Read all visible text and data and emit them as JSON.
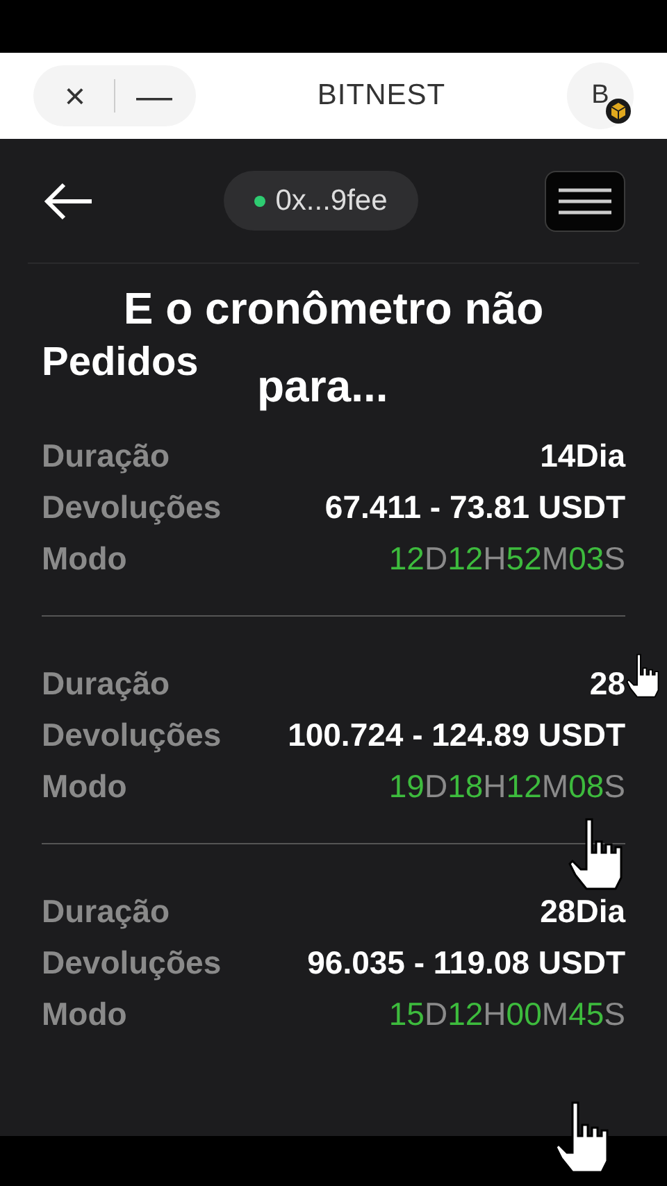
{
  "header": {
    "close": "×",
    "minimize": "—",
    "title": "BITNEST",
    "avatar": "B"
  },
  "nav": {
    "wallet": "0x...9fee",
    "connected": true
  },
  "caption": {
    "line_1": "E o cronômetro não",
    "line_2": "para..."
  },
  "page_title": "Pedidos",
  "orders": [
    {
      "duration_label": "Duração",
      "duration": "14Dia",
      "returns_label": "Devoluções",
      "returns": "67.411 - 73.81 USDT",
      "mode_label": "Modo",
      "timer": [
        {
          "kind": "number",
          "text": "12"
        },
        {
          "kind": "unit",
          "text": "D"
        },
        {
          "kind": "number",
          "text": "12"
        },
        {
          "kind": "unit",
          "text": "H"
        },
        {
          "kind": "number",
          "text": "52"
        },
        {
          "kind": "unit",
          "text": "M"
        },
        {
          "kind": "number",
          "text": "03"
        },
        {
          "kind": "unit",
          "text": "S"
        }
      ]
    },
    {
      "duration_label": "Duração",
      "duration": "28",
      "returns_label": "Devoluções",
      "returns": "100.724 - 124.89 USDT",
      "mode_label": "Modo",
      "timer": [
        {
          "kind": "number",
          "text": "19"
        },
        {
          "kind": "unit",
          "text": "D"
        },
        {
          "kind": "number",
          "text": "18"
        },
        {
          "kind": "unit",
          "text": "H"
        },
        {
          "kind": "number",
          "text": "12"
        },
        {
          "kind": "unit",
          "text": "M"
        },
        {
          "kind": "number",
          "text": "08"
        },
        {
          "kind": "unit",
          "text": "S"
        }
      ]
    },
    {
      "duration_label": "Duração",
      "duration": "28Dia",
      "returns_label": "Devoluções",
      "returns": "96.035 - 119.08 USDT",
      "mode_label": "Modo",
      "timer": [
        {
          "kind": "number",
          "text": "15"
        },
        {
          "kind": "unit",
          "text": "D"
        },
        {
          "kind": "number",
          "text": "12"
        },
        {
          "kind": "unit",
          "text": "H"
        },
        {
          "kind": "number",
          "text": "00"
        },
        {
          "kind": "unit",
          "text": "M"
        },
        {
          "kind": "number",
          "text": "45"
        },
        {
          "kind": "unit",
          "text": "S"
        }
      ]
    }
  ]
}
